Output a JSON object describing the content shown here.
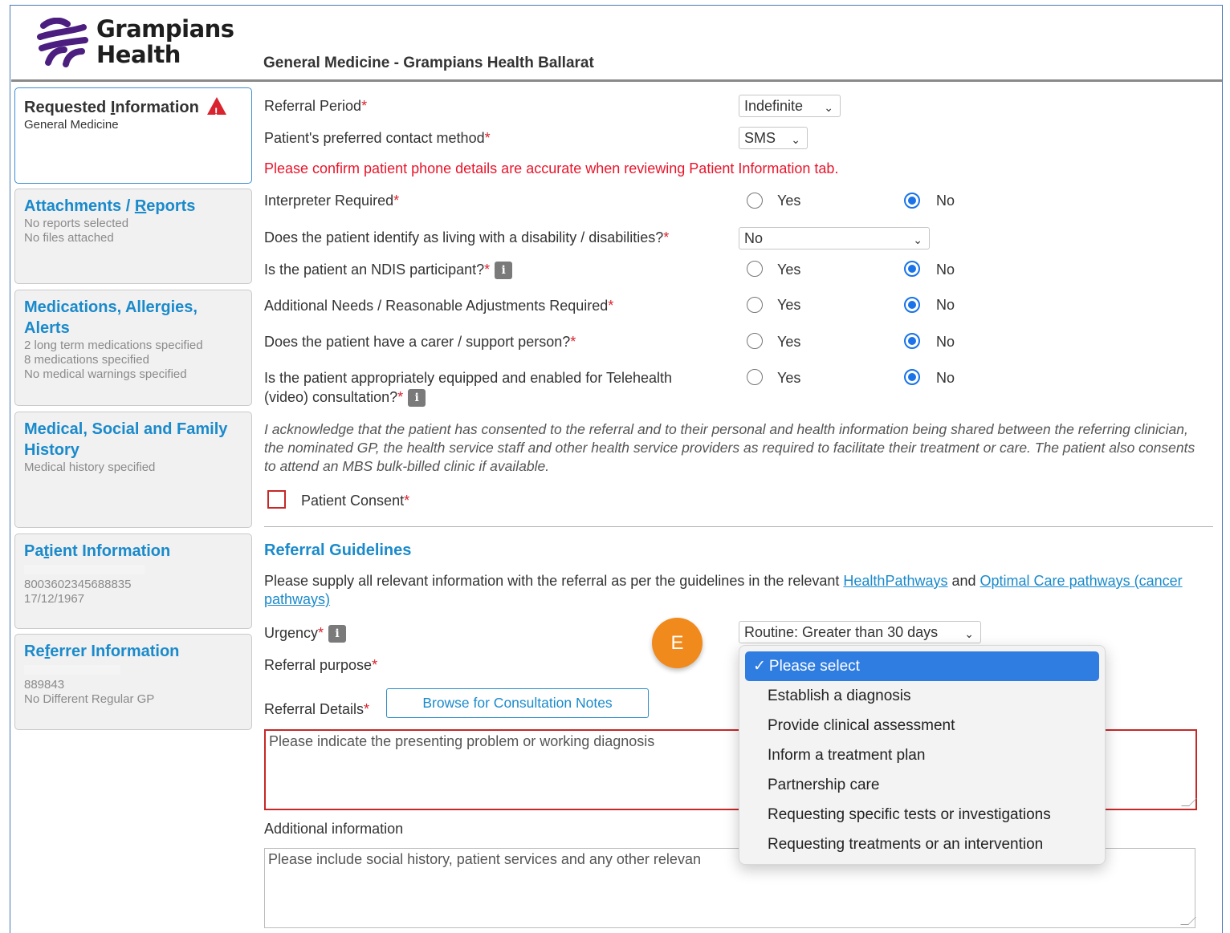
{
  "brand": {
    "line1": "Grampians",
    "line2": "Health",
    "color": "#4b1e7f"
  },
  "page_title": "General Medicine - Grampians Health Ballarat",
  "sidebar": {
    "items": [
      {
        "title_parts": [
          "Requested ",
          "I",
          "nformation"
        ],
        "subs": [
          "General Medicine"
        ],
        "active": true,
        "warning": true
      },
      {
        "title_parts": [
          "Attachments / ",
          "R",
          "eports"
        ],
        "subs": [
          "No reports selected",
          "No files attached"
        ]
      },
      {
        "title_lines": [
          "Medications, Allergies,",
          "Alerts"
        ],
        "subs": [
          "2 long term medications specified",
          "8 medications specified",
          "No medical warnings specified"
        ]
      },
      {
        "title_lines": [
          "Medical, Social and Family",
          "History"
        ],
        "subs": [
          "Medical history specified"
        ]
      },
      {
        "title_parts": [
          "Pa",
          "t",
          "ient Information"
        ],
        "subs": [
          "8003602345688835",
          "17/12/1967"
        ]
      },
      {
        "title_parts": [
          "Re",
          "f",
          "errer Information"
        ],
        "subs": [
          "889843",
          "No Different Regular GP"
        ]
      }
    ]
  },
  "form": {
    "referral_period": {
      "label": "Referral Period",
      "value": "Indefinite"
    },
    "contact_method": {
      "label": "Patient's preferred contact method",
      "value": "SMS"
    },
    "phone_note": "Please confirm patient phone details are accurate when reviewing Patient Information tab.",
    "interpreter": {
      "label": "Interpreter Required",
      "selected": "No"
    },
    "disability": {
      "label": "Does the patient identify as living with a disability / disabilities?",
      "value": "No"
    },
    "ndis": {
      "label": "Is the patient an NDIS participant?",
      "selected": "No"
    },
    "additional_needs": {
      "label": "Additional Needs / Reasonable Adjustments Required",
      "selected": "No"
    },
    "carer": {
      "label": "Does the patient have a carer / support person?",
      "selected": "No"
    },
    "telehealth": {
      "label_line1": "Is the patient appropriately equipped and enabled for Telehealth",
      "label_line2": "(video) consultation?",
      "selected": "No"
    },
    "yes": "Yes",
    "no": "No",
    "required_mark": "*",
    "info_glyph": "i",
    "consent_text": "I acknowledge that the patient has consented to the referral and to their personal and health information being shared between the referring clinician, the nominated GP, the health service staff and other health service providers as required to facilitate their treatment or care. The patient also consents to attend an MBS bulk-billed clinic if available.",
    "consent_label": "Patient Consent",
    "guidelines_title": "Referral Guidelines",
    "guidelines_text_before": "Please supply all relevant information with the referral as per the guidelines in the relevant ",
    "guidelines_link1": "HealthPathways",
    "guidelines_and": " and ",
    "guidelines_link2": "Optimal Care pathways (cancer pathways)",
    "urgency": {
      "label": "Urgency",
      "value": "Routine: Greater than 30 days"
    },
    "referral_purpose": {
      "label": "Referral purpose"
    },
    "referral_details": {
      "label": "Referral Details",
      "placeholder": "Please indicate the presenting problem or working diagnosis"
    },
    "browse_button": "Browse for Consultation Notes",
    "additional_info": {
      "label": "Additional information",
      "placeholder": "Please include social history, patient services and any other relevan"
    }
  },
  "step_badge": "E",
  "purpose_dropdown": {
    "selected_index": 0,
    "check": "✓",
    "options": [
      "Please select",
      "Establish a diagnosis",
      "Provide clinical assessment",
      "Inform a treatment plan",
      "Partnership care",
      "Requesting specific tests or investigations",
      "Requesting treatments or an intervention"
    ]
  }
}
